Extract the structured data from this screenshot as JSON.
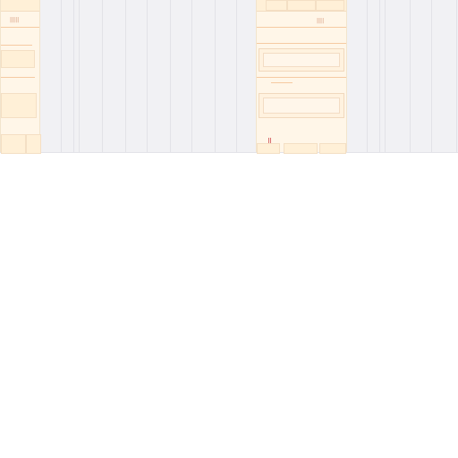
{
  "layout": {
    "background": "#ffffff",
    "strip_color": "#f1f1f4",
    "card_color": "#fff6e8",
    "accent": "#d86b6b"
  },
  "cards": [
    {
      "id": "left-card",
      "markers": "|||||",
      "title": ""
    },
    {
      "id": "main-card",
      "markers": "||||",
      "title": ""
    }
  ]
}
